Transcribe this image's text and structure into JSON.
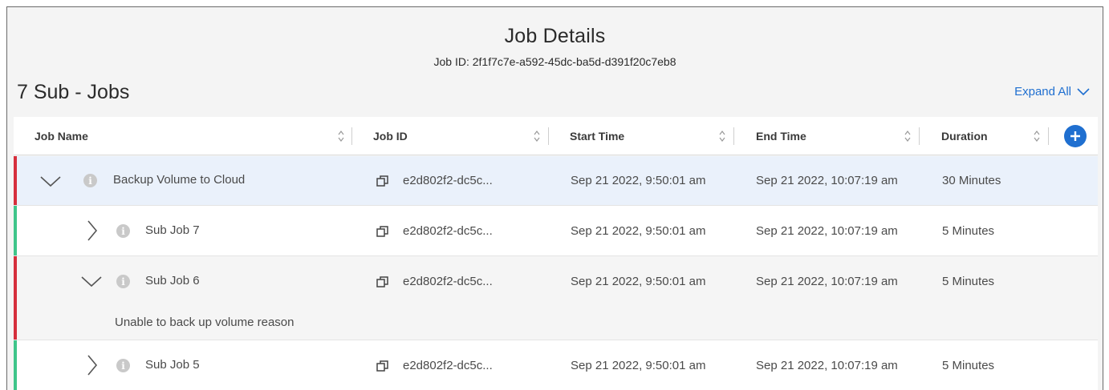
{
  "header": {
    "title": "Job Details",
    "job_id_line": "Job ID: 2f1f7c7e-a592-45dc-ba5d-d391f20c7eb8",
    "sub_jobs_count": "7 Sub - Jobs",
    "expand_all": "Expand All"
  },
  "columns": {
    "job_name": "Job Name",
    "job_id": "Job ID",
    "start_time": "Start Time",
    "end_time": "End Time",
    "duration": "Duration"
  },
  "rows": [
    {
      "name": "Backup Volume to Cloud",
      "job_id": "e2d802f2-dc5c...",
      "start": "Sep 21 2022, 9:50:01 am",
      "end": "Sep 21 2022, 10:07:19 am",
      "duration": "30 Minutes",
      "status": "failed",
      "expanded": true
    },
    {
      "name": "Sub Job 7",
      "job_id": "e2d802f2-dc5c...",
      "start": "Sep 21 2022, 9:50:01 am",
      "end": "Sep 21 2022, 10:07:19 am",
      "duration": "5 Minutes",
      "status": "success",
      "expanded": false
    },
    {
      "name": "Sub Job 6",
      "job_id": "e2d802f2-dc5c...",
      "start": "Sep 21 2022, 9:50:01 am",
      "end": "Sep 21 2022, 10:07:19 am",
      "duration": "5 Minutes",
      "status": "failed",
      "expanded": true,
      "reason": "Unable to back up volume reason"
    },
    {
      "name": "Sub Job 5",
      "job_id": "e2d802f2-dc5c...",
      "start": "Sep 21 2022, 9:50:01 am",
      "end": "Sep 21 2022, 10:07:19 am",
      "duration": "5 Minutes",
      "status": "success",
      "expanded": false
    }
  ],
  "colors": {
    "accent": "#1f6fd0",
    "failed": "#d62f3c",
    "success": "#3fc58a"
  },
  "icons": {
    "expand": "chevron-down-icon",
    "collapse": "chevron-right-icon",
    "info": "info-icon",
    "copy": "copy-icon",
    "sort": "sort-icon",
    "add": "plus-circle-icon"
  }
}
